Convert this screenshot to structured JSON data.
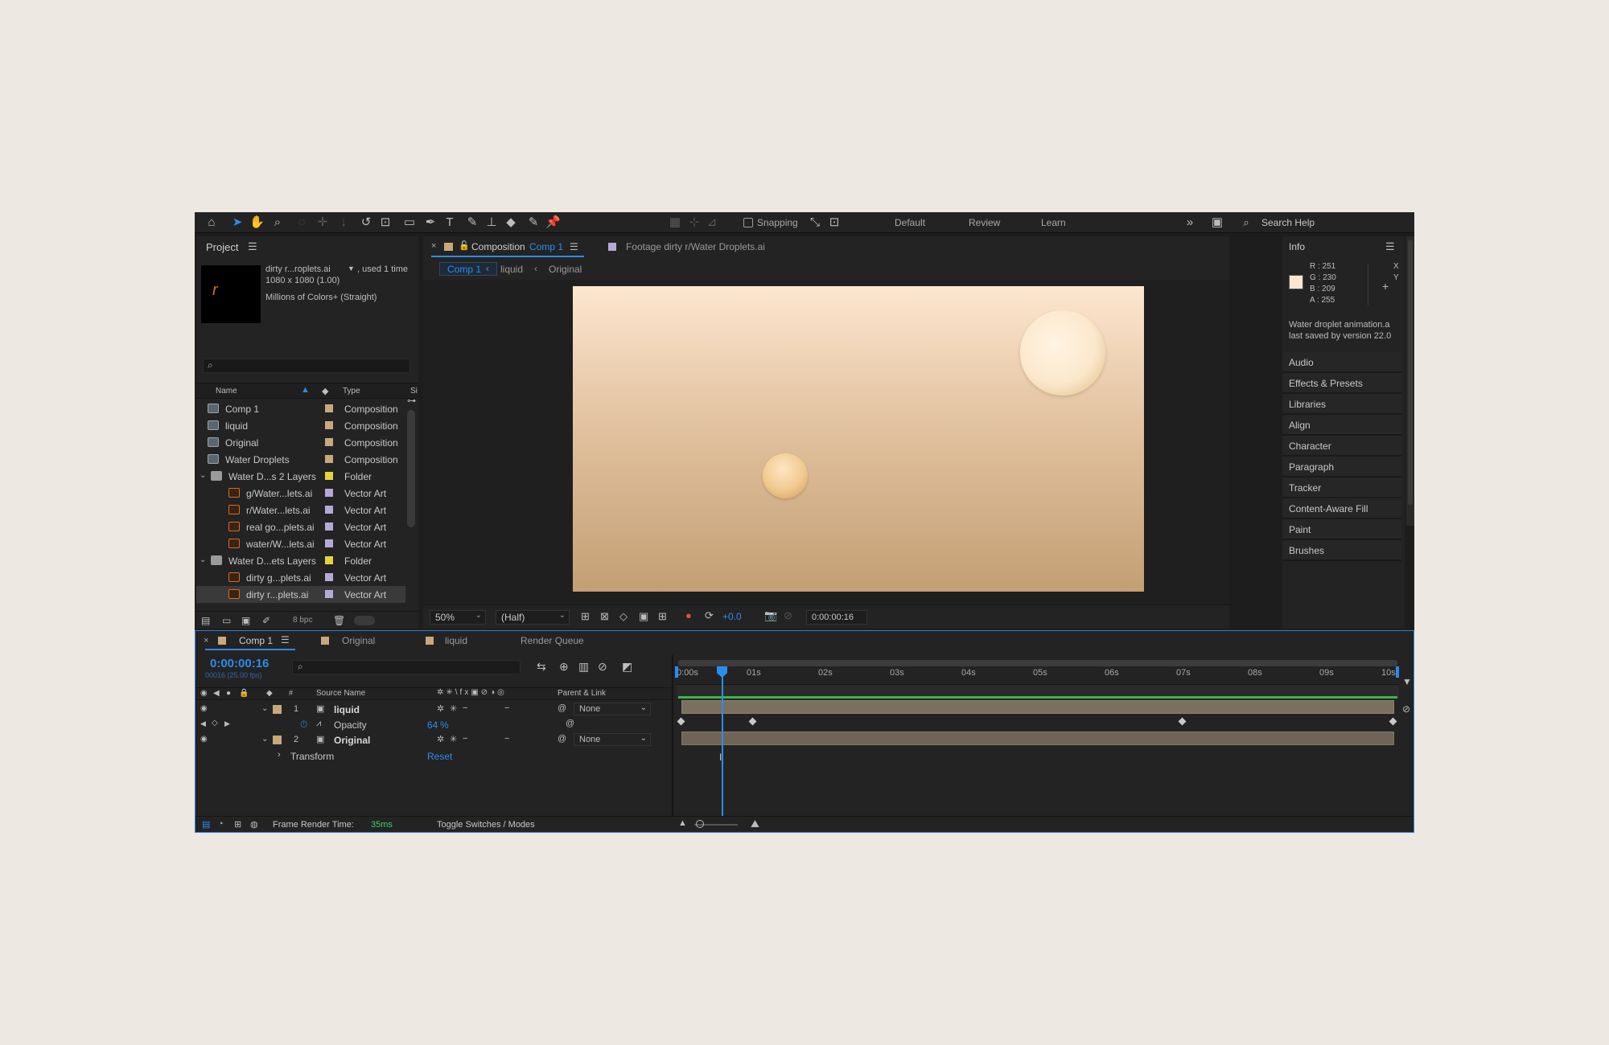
{
  "toolbar": {
    "snapping_label": "Snapping",
    "workspaces": [
      "Default",
      "Review",
      "Learn"
    ],
    "search_placeholder": "Search Help"
  },
  "project": {
    "title": "Project",
    "selected_name": "dirty r...roplets.ai",
    "used_text": ", used 1 time",
    "dimensions": "1080 x 1080 (1.00)",
    "color_info": "Millions of Colors+ (Straight)",
    "thumb_glyph": "r",
    "columns": {
      "name": "Name",
      "type": "Type",
      "size": "Si"
    },
    "items": [
      {
        "name": "Comp 1",
        "type": "Composition",
        "kind": "comp",
        "label_color": "#c9a87c",
        "indent": 0
      },
      {
        "name": "liquid",
        "type": "Composition",
        "kind": "comp",
        "label_color": "#c9a87c",
        "indent": 0
      },
      {
        "name": "Original",
        "type": "Composition",
        "kind": "comp",
        "label_color": "#c9a87c",
        "indent": 0
      },
      {
        "name": "Water Droplets",
        "type": "Composition",
        "kind": "comp",
        "label_color": "#c9a87c",
        "indent": 0
      },
      {
        "name": "Water D...s 2 Layers",
        "type": "Folder",
        "kind": "folder",
        "label_color": "#e6d33c",
        "indent": 0
      },
      {
        "name": "g/Water...lets.ai",
        "type": "Vector Art",
        "kind": "ai",
        "label_color": "#b5a9d6",
        "indent": 1
      },
      {
        "name": "r/Water...lets.ai",
        "type": "Vector Art",
        "kind": "ai",
        "label_color": "#b5a9d6",
        "indent": 1
      },
      {
        "name": "real go...plets.ai",
        "type": "Vector Art",
        "kind": "ai",
        "label_color": "#b5a9d6",
        "indent": 1
      },
      {
        "name": "water/W...lets.ai",
        "type": "Vector Art",
        "kind": "ai",
        "label_color": "#b5a9d6",
        "indent": 1
      },
      {
        "name": "Water D...ets Layers",
        "type": "Folder",
        "kind": "folder",
        "label_color": "#e6d33c",
        "indent": 0
      },
      {
        "name": "dirty g...plets.ai",
        "type": "Vector Art",
        "kind": "ai",
        "label_color": "#b5a9d6",
        "indent": 1
      },
      {
        "name": "dirty r...plets.ai",
        "type": "Vector Art",
        "kind": "ai",
        "label_color": "#b5a9d6",
        "indent": 1
      }
    ],
    "bpc_label": "8 bpc"
  },
  "composition": {
    "tab_prefix": "Composition",
    "tab_name": "Comp 1",
    "footage_tab": "Footage  dirty r/Water Droplets.ai",
    "breadcrumbs": [
      "Comp 1",
      "liquid",
      "Original"
    ],
    "zoom": "50%",
    "resolution": "(Half)",
    "exposure": "+0.0",
    "timecode": "0:00:00:16"
  },
  "info": {
    "title": "Info",
    "r": "R : 251",
    "g": "G : 230",
    "b": "B : 209",
    "a": "A : 255",
    "x": "X",
    "y": "Y",
    "swatch_color": "#fbe6d1",
    "note_line1": "Water droplet animation.a",
    "note_line2": "last saved by version 22.0",
    "panels": [
      "Audio",
      "Effects & Presets",
      "Libraries",
      "Align",
      "Character",
      "Paragraph",
      "Tracker",
      "Content-Aware Fill",
      "Paint",
      "Brushes"
    ]
  },
  "timeline": {
    "tabs": [
      "Comp 1",
      "Original",
      "liquid",
      "Render Queue"
    ],
    "timecode": "0:00:00:16",
    "frames": "00016 (25.00 fps)",
    "col_source": "Source Name",
    "col_parent": "Parent & Link",
    "ruler": [
      "0:00s",
      "01s",
      "02s",
      "03s",
      "04s",
      "05s",
      "06s",
      "07s",
      "08s",
      "09s",
      "10s"
    ],
    "layers": [
      {
        "num": "1",
        "name": "liquid",
        "parent": "None"
      },
      {
        "num": "2",
        "name": "Original",
        "parent": "None"
      }
    ],
    "opacity_label": "Opacity",
    "opacity_value": "64",
    "opacity_unit": "%",
    "transform_label": "Transform",
    "reset_label": "Reset",
    "render_label": "Frame Render Time:",
    "render_value": "35ms",
    "toggle_label": "Toggle Switches / Modes"
  }
}
